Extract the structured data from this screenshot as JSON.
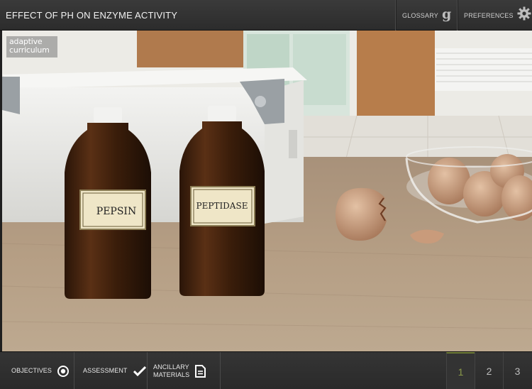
{
  "header": {
    "title": "EFFECT OF PH ON ENZYME ACTIVITY",
    "glossary_label": "GLOSSARY",
    "preferences_label": "PREFERENCES"
  },
  "scene": {
    "logo_line1": "adaptive",
    "logo_line2": "curriculum",
    "bottle1_label": "PEPSIN",
    "bottle2_label": "PEPTIDASE"
  },
  "footer": {
    "objectives_label": "OBJECTIVES",
    "assessment_label": "ASSESSMENT",
    "ancillary_line1": "ANCILLARY",
    "ancillary_line2": "MATERIALS",
    "pages": [
      "1",
      "2",
      "3"
    ],
    "current_page": "1"
  },
  "colors": {
    "accent_active_page": "#8a9a49",
    "bar_background": "#2f2f2f"
  }
}
